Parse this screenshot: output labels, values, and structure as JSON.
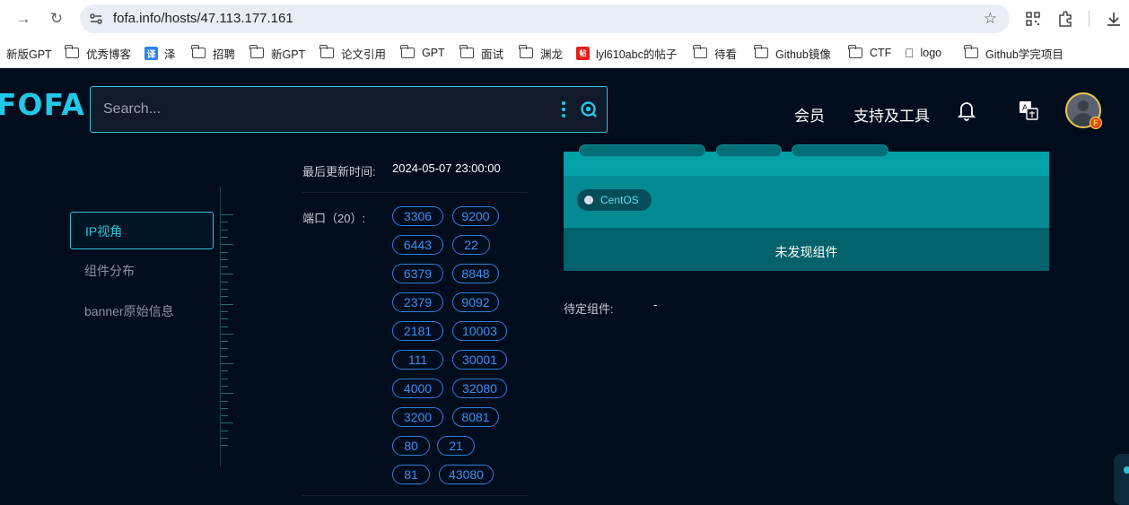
{
  "browser": {
    "url": "fofa.info/hosts/47.113.177.161",
    "bookmarks": [
      {
        "label": "新版GPT",
        "kind": "none"
      },
      {
        "label": "优秀博客",
        "kind": "folder"
      },
      {
        "label": "泽",
        "kind": "translate"
      },
      {
        "label": "招聘",
        "kind": "folder"
      },
      {
        "label": "新GPT",
        "kind": "folder"
      },
      {
        "label": "论文引用",
        "kind": "folder"
      },
      {
        "label": "GPT",
        "kind": "folder"
      },
      {
        "label": "面试",
        "kind": "folder"
      },
      {
        "label": "渊龙",
        "kind": "folder"
      },
      {
        "label": "lyl610abc的帖子",
        "kind": "red"
      },
      {
        "label": "待看",
        "kind": "folder"
      },
      {
        "label": "Github镜像",
        "kind": "folder"
      },
      {
        "label": "CTF",
        "kind": "folder"
      },
      {
        "label": "logo",
        "kind": "apple"
      },
      {
        "label": "Github学完项目",
        "kind": "folder"
      }
    ],
    "translate_glyph": "译",
    "red_glyph": "帖"
  },
  "header": {
    "logo": "FOFA",
    "search_placeholder": "Search...",
    "nav": [
      "会员",
      "支持及工具"
    ],
    "avatar_badge": "F"
  },
  "sidebar": {
    "items": [
      {
        "label": "IP视角",
        "active": true
      },
      {
        "label": "组件分布",
        "active": false
      },
      {
        "label": "banner原始信息",
        "active": false
      }
    ]
  },
  "host_info": {
    "last_update_label": "最后更新时间:",
    "last_update_value": "2024-05-07 23:00:00",
    "ports_label": "端口（20）:",
    "ports": [
      "3306",
      "9200",
      "6443",
      "22",
      "6379",
      "8848",
      "2379",
      "9092",
      "2181",
      "10003",
      "111",
      "30001",
      "4000",
      "32080",
      "3200",
      "8081",
      "80",
      "21",
      "81",
      "43080"
    ]
  },
  "components": {
    "os": "CentOS",
    "no_component_text": "未发现组件",
    "pending_label": "待定组件:",
    "pending_value": "-"
  }
}
